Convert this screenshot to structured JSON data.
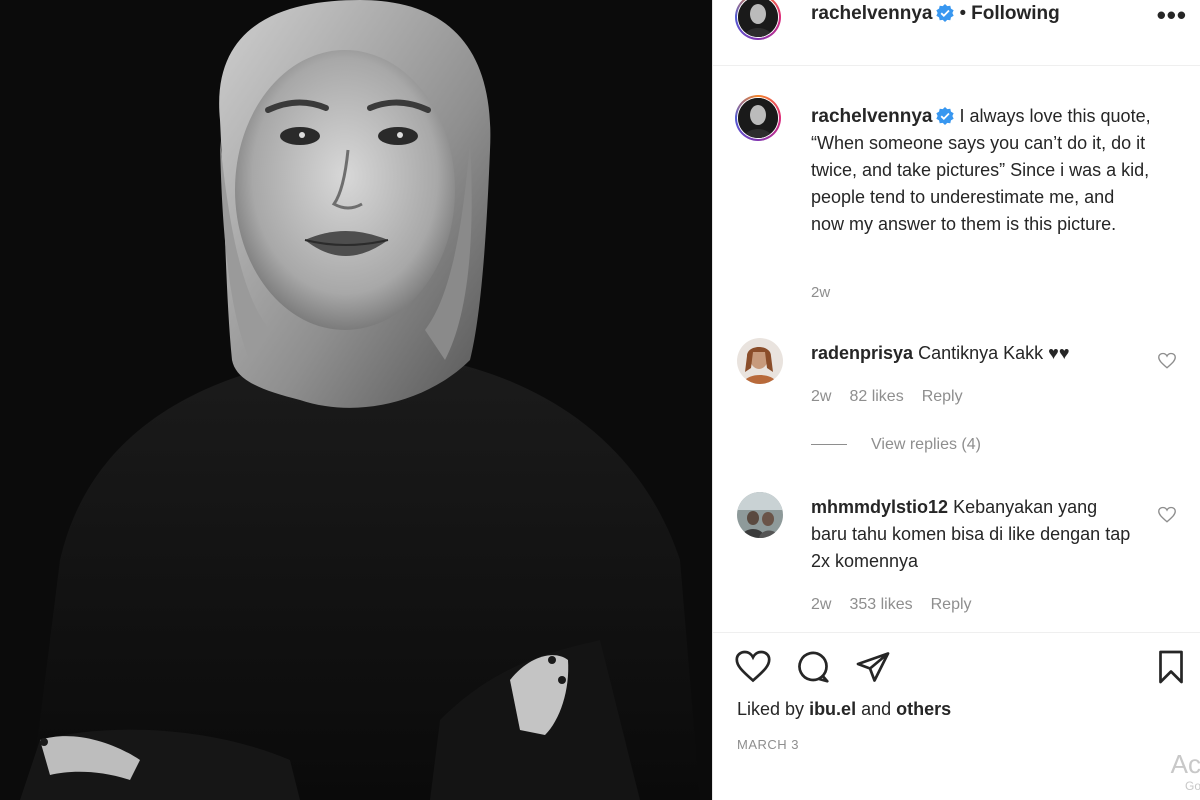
{
  "post": {
    "username": "rachelvennya",
    "follow_separator": "•",
    "follow_status": "Following",
    "more_label": "•••"
  },
  "caption": {
    "username": "rachelvennya",
    "text": "I always love this quote, “When someone says you can’t do it, do it twice, and take pictures” Since i was a kid, people tend to underestimate me, and now my answer to them is this picture.",
    "time": "2w"
  },
  "comments": [
    {
      "username": "radenprisya",
      "text": "Cantiknya Kakk ♥♥",
      "time": "2w",
      "likes": "82 likes",
      "reply": "Reply"
    },
    {
      "username": "mhmmdylstio12",
      "text": "Kebanyakan yang baru tahu komen bisa di like dengan tap 2x komennya",
      "time": "2w",
      "likes": "353 likes",
      "reply": "Reply"
    }
  ],
  "view_replies": "View replies (4)",
  "footer": {
    "liked_prefix": "Liked by",
    "liked_user": "ibu.el",
    "liked_and": "and",
    "liked_others": "others",
    "date": "MARCH 3",
    "watermark_line1": "Ac",
    "watermark_line2": "Go"
  },
  "icons": {
    "like": "heart-icon",
    "comment": "comment-icon",
    "share": "share-icon",
    "save": "bookmark-icon",
    "verified": "verified-badge-icon",
    "comment_like": "heart-icon"
  },
  "colors": {
    "verified": "#3897f0",
    "muted": "#8e8e8e",
    "text": "#262626"
  }
}
